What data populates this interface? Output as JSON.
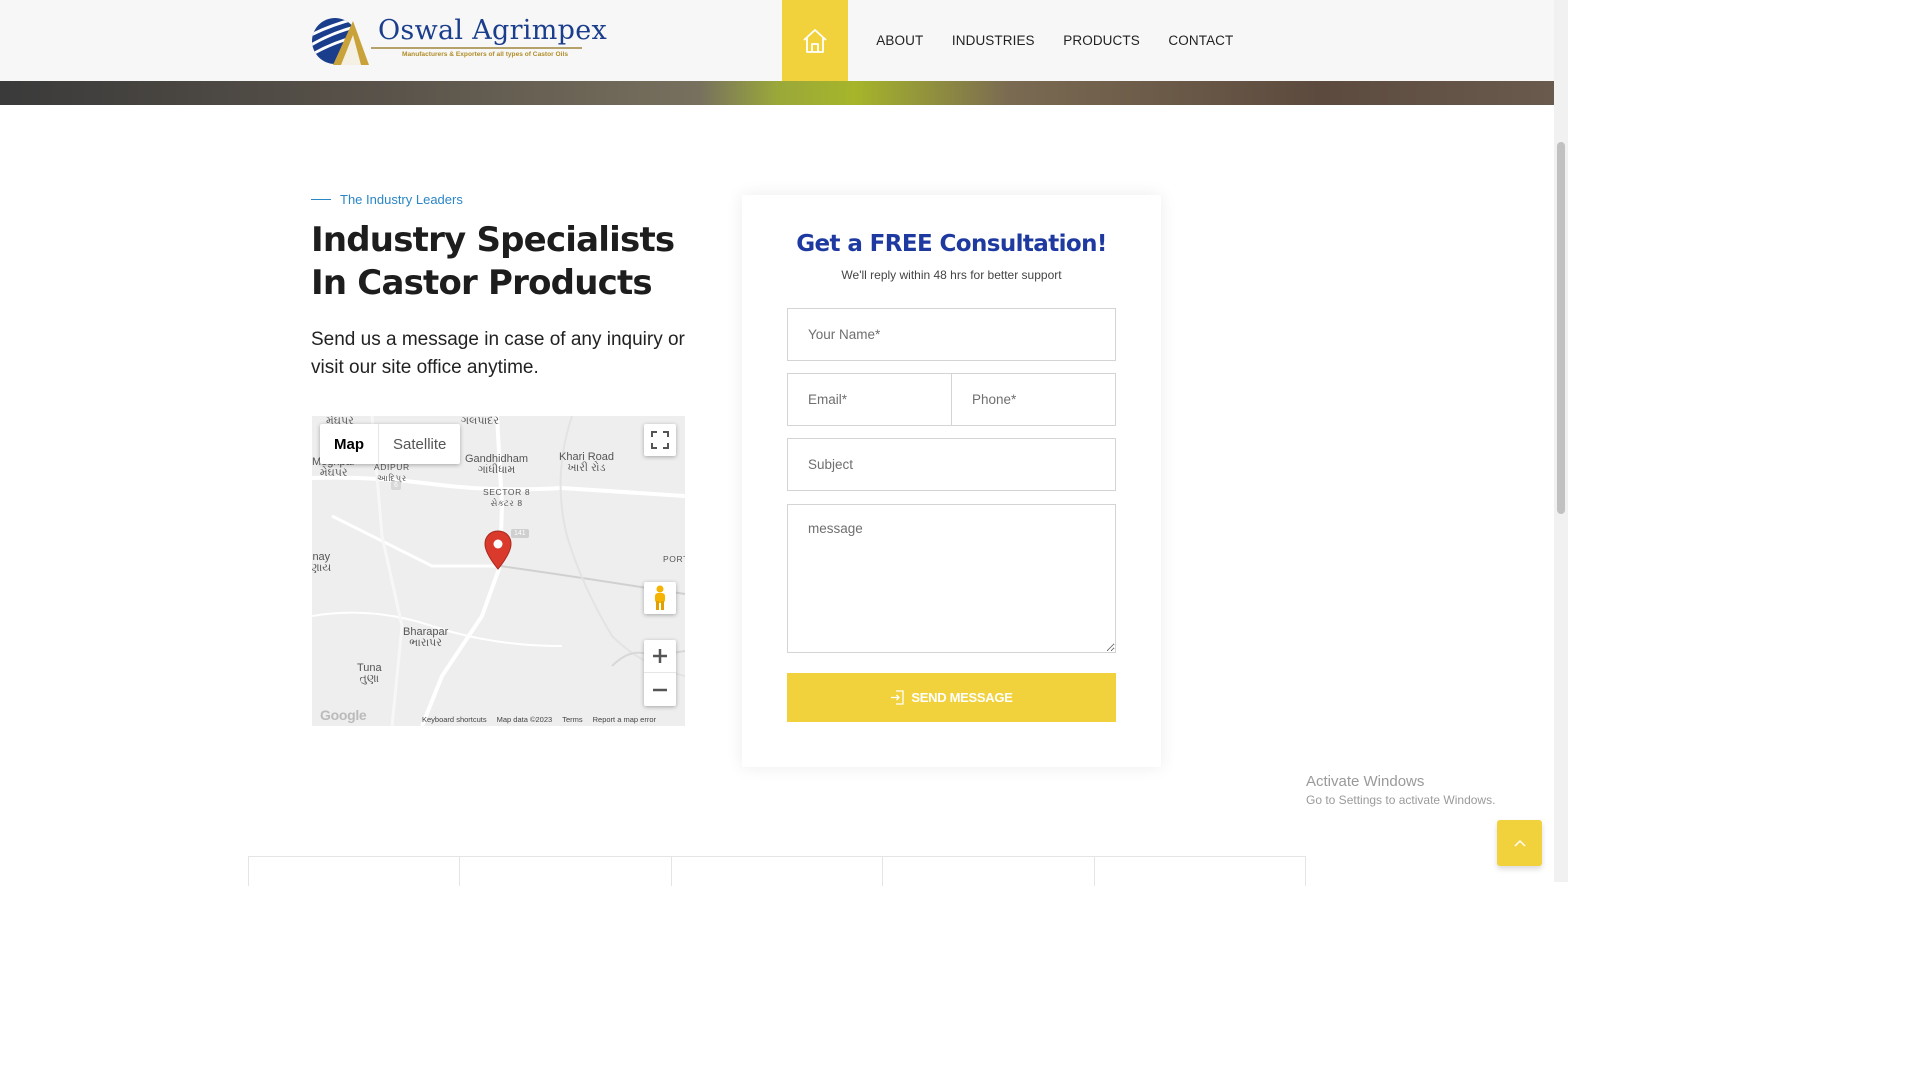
{
  "header": {
    "logo": {
      "name": "Oswal Agrimpex",
      "tagline": "Manufacturers & Exporters of all types of Castor Oils"
    },
    "home_icon": "home-icon",
    "nav": [
      {
        "label": "ABOUT"
      },
      {
        "label": "INDUSTRIES"
      },
      {
        "label": "PRODUCTS"
      },
      {
        "label": "CONTACT"
      }
    ]
  },
  "intro": {
    "eyebrow": "The Industry Leaders",
    "headline_line1": "Industry Specialists",
    "headline_line2": "In Castor Products",
    "body": "Send us a message in case of any inquiry or visit our site office anytime."
  },
  "map": {
    "tab_map": "Map",
    "tab_satellite": "Satellite",
    "places": {
      "meghpar": "Meghpar",
      "meghpar_guj": "મેઘપર",
      "adipur": "ADIPUR",
      "adipur_guj": "આદિપુર",
      "gandhidham": "Gandhidham",
      "gandhidham_guj": "ગાંધીધામ",
      "khari_road": "Khari Road",
      "khari_road_guj": "ખારી રોડ",
      "sector8": "SECTOR 8",
      "sector8_guj": "સેક્ટર 8",
      "inay": "inay",
      "inay_guj": "ણાય",
      "port": "PORT",
      "bharapar": "Bharapar",
      "bharapar_guj": "ભારાપર",
      "tuna": "Tuna",
      "tuna_guj": "તુણા",
      "top_left_guj": "મેઘપર",
      "top_mid_guj": "ગલપાદર"
    },
    "road_badge": "141",
    "road_badge_small": "6",
    "google": "Google",
    "footer": {
      "keyboard": "Keyboard shortcuts",
      "data": "Map data ©2023",
      "terms": "Terms",
      "report": "Report a map error"
    }
  },
  "form": {
    "title": "Get a FREE Consultation!",
    "subtitle": "We'll reply within 48 hrs for better support",
    "name_placeholder": "Your Name*",
    "email_placeholder": "Email*",
    "phone_placeholder": "Phone*",
    "subject_placeholder": "Subject",
    "message_placeholder": "message",
    "submit_label": "SEND MESSAGE"
  },
  "watermark": {
    "title": "Activate Windows",
    "subtitle": "Go to Settings to activate Windows."
  },
  "colors": {
    "accent_yellow": "#f2d23c",
    "brand_blue": "#1e3aa0",
    "eyebrow_blue": "#2b86c5",
    "pin_red": "#d93a2b"
  }
}
